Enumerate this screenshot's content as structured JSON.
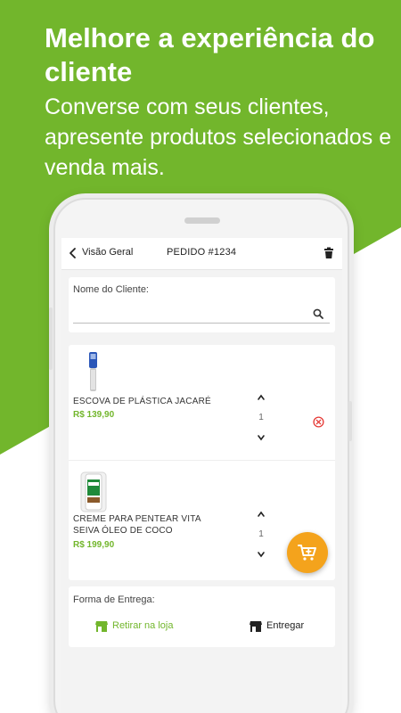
{
  "hero": {
    "headline": "Melhore a experiência do cliente",
    "subhead": "Converse com seus clientes, apresente produtos selecionados e venda mais."
  },
  "appbar": {
    "back_label": "Visão Geral",
    "title": "PEDIDO #1234",
    "back_icon": "chevron-left-icon",
    "action_icon": "trash-icon"
  },
  "client": {
    "label": "Nome do Cliente:",
    "value": "",
    "placeholder": "",
    "icon": "search-icon"
  },
  "items": [
    {
      "name": "ESCOVA DE PLÁSTICA JACARÉ",
      "price": "R$ 139,90",
      "quantity": "1"
    },
    {
      "name": "CREME PARA PENTEAR VITA SEIVA ÓLEO DE COCO",
      "price": "R$ 199,90",
      "quantity": "1"
    }
  ],
  "delivery": {
    "label": "Forma de Entrega:",
    "options": [
      {
        "label": "Retirar na loja",
        "selected": true
      },
      {
        "label": "Entregar",
        "selected": false
      }
    ]
  },
  "fab": {
    "icon": "add-to-cart-icon"
  },
  "colors": {
    "brand_green": "#72b62c",
    "fab_orange": "#f4a31c",
    "remove_red": "#e53935"
  }
}
